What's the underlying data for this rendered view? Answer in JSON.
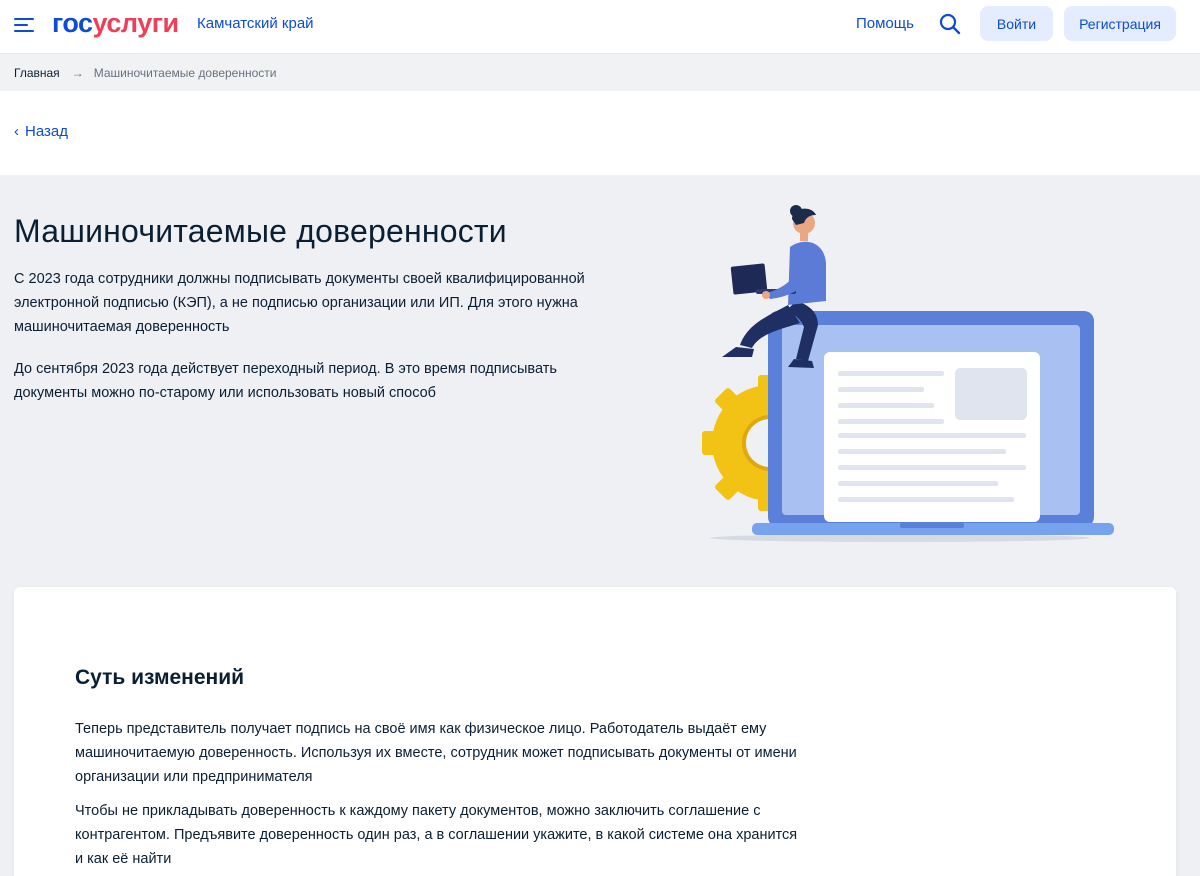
{
  "header": {
    "logo_part1": "гос",
    "logo_part2": "услуги",
    "region": "Камчатский край",
    "help": "Помощь",
    "login": "Войти",
    "register": "Регистрация",
    "menu_icon": "burger-menu-icon",
    "search_icon": "search-icon"
  },
  "breadcrumb": {
    "home": "Главная",
    "separator_icon": "arrow-right-icon",
    "arrow": "→",
    "current": "Машиночитаемые доверенности"
  },
  "back": {
    "label": "Назад",
    "icon": "chevron-left-icon",
    "glyph": "‹"
  },
  "hero": {
    "title": "Машиночитаемые доверенности",
    "paragraph1": "С 2023 года сотрудники должны подписывать документы своей квалифицированной электронной подписью (КЭП), а не подписью организации или ИП. Для этого нужна машиночитаемая доверенность",
    "paragraph2": "До сентября 2023 года действует переходный период. В это время подписывать документы можно по-старому или использовать новый способ",
    "illustration_icon": "person-laptop-illustration"
  },
  "card": {
    "title": "Суть изменений",
    "paragraph1": "Теперь представитель получает подпись на своё имя как физическое лицо. Работодатель выдаёт ему машиночитаемую доверенность. Используя их вместе, сотрудник может подписывать документы от имени организации или предпринимателя",
    "paragraph2": "Чтобы не прикладывать доверенность к каждому пакету документов, можно заключить соглашение с контрагентом. Предъявите доверенность один раз, а в соглашении укажите, в какой системе она хранится и как её найти"
  },
  "colors": {
    "brand_blue": "#0d4cd3",
    "brand_red": "#ee3f58",
    "button_bg": "#e4ecfd",
    "hero_bg": "#eef0f4",
    "text": "#0b1f33"
  }
}
